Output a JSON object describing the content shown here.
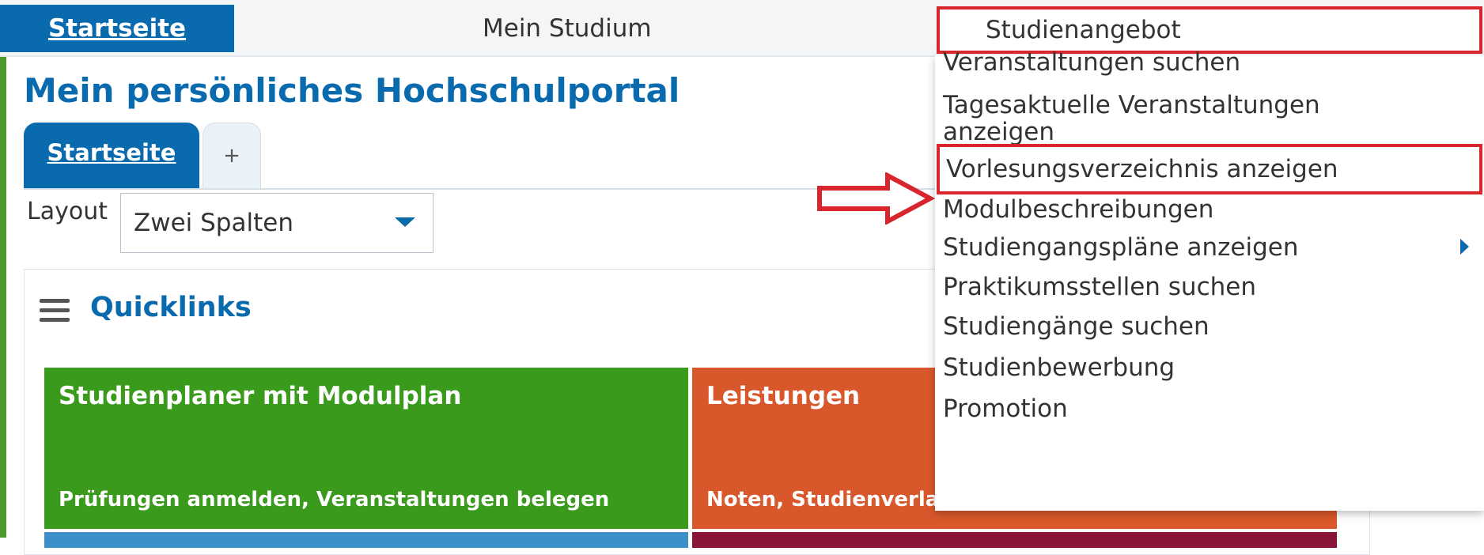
{
  "topnav": {
    "home": "Startseite",
    "my_studies": "Mein Studium",
    "study_offer": "Studienangebot"
  },
  "page": {
    "title": "Mein persönliches Hochschulportal"
  },
  "tabs": {
    "active": "Startseite",
    "add": "+"
  },
  "layout": {
    "label": "Layout",
    "selected": "Zwei Spalten"
  },
  "quicklinks": {
    "title": "Quicklinks",
    "tiles": [
      {
        "title": "Studienplaner mit Modulplan",
        "subtitle": "Prüfungen anmelden, Veranstaltungen belegen",
        "color": "#3a9a1c"
      },
      {
        "title": "Leistungen",
        "subtitle": "Noten, Studienverla",
        "color": "#d9582b"
      }
    ]
  },
  "menu": {
    "items": [
      "Veranstaltungen suchen",
      "Tagesaktuelle Veranstaltungen",
      "anzeigen",
      "Vorlesungsverzeichnis anzeigen",
      "Modulbeschreibungen",
      "Studiengangspläne anzeigen",
      "Praktikumsstellen suchen",
      "Studiengänge suchen",
      "Studienbewerbung",
      "Promotion"
    ]
  },
  "colors": {
    "primary": "#0a6aae",
    "highlight_border": "#d9262e",
    "accent_green": "#4a9b2b"
  }
}
